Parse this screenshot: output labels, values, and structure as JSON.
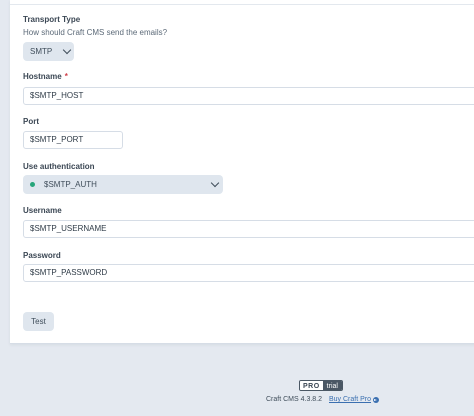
{
  "form": {
    "transport": {
      "label": "Transport Type",
      "instructions": "How should Craft CMS send the emails?",
      "value": "SMTP"
    },
    "hostname": {
      "label": "Hostname",
      "required_mark": "*",
      "value": "$SMTP_HOST"
    },
    "port": {
      "label": "Port",
      "value": "$SMTP_PORT"
    },
    "auth": {
      "label": "Use authentication",
      "value": "$SMTP_AUTH",
      "status_color": "#27a57a"
    },
    "username": {
      "label": "Username",
      "value": "$SMTP_USERNAME"
    },
    "password": {
      "label": "Password",
      "value": "$SMTP_PASSWORD"
    },
    "test_button": "Test"
  },
  "footer": {
    "edition": "PRO",
    "edition_status": "trial",
    "version": "Craft CMS 4.3.8.2",
    "buy_link": "Buy Craft Pro",
    "buy_icon": "arrow-circle-right-icon"
  }
}
